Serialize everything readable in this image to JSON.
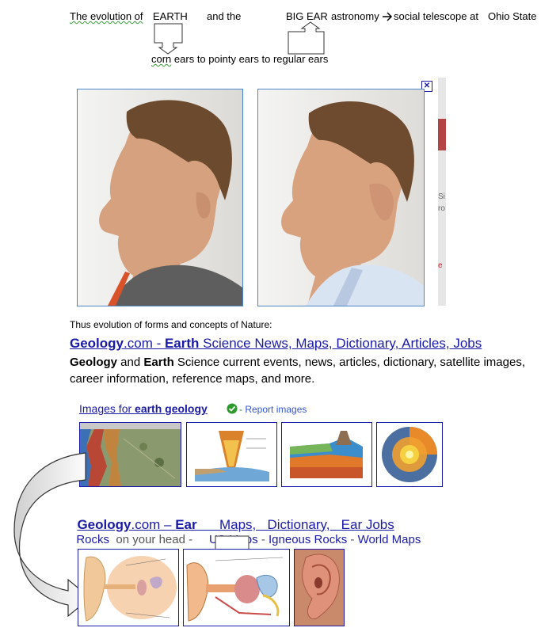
{
  "header": {
    "line1": {
      "the_evolution_of": "The evolution of",
      "earth": "EARTH",
      "and_the": "and the",
      "big_ear": "BIG EAR",
      "astronomy": "astronomy",
      "social_telescope": "social telescope at",
      "ohio_state": "Ohio  State"
    },
    "line2": {
      "corn": "corn",
      "ears_to_pointy": "ears to pointy ears",
      "to_regular_ears": "to regular  ears"
    }
  },
  "popup": {
    "close_glyph": "✕",
    "side_text_1": "Si",
    "side_text_2": "ro",
    "side_text_3": "e"
  },
  "caption": "Thus evolution of forms and concepts of Nature:",
  "result1": {
    "title_parts": [
      "Geology",
      ".com - ",
      "Earth",
      " Science News, Maps, Dictionary, Articles, Jobs"
    ],
    "desc_parts": [
      "Geology",
      " and ",
      "Earth",
      " Science current events, news, articles, dictionary, satellite images,"
    ],
    "desc_line2": "career information, reference maps, and more."
  },
  "images_for": {
    "prefix": "Images for ",
    "query": "earth geology",
    "separator": " - ",
    "report": "Report images"
  },
  "result2": {
    "title_parts": [
      "Geology",
      ".com – ",
      "Ear",
      "      Maps,   Dictionary,   Ear Jobs"
    ],
    "links": {
      "rocks": "Rocks",
      "on_your_head": "on your head",
      "dash": "-",
      "us_maps": "US Maps",
      "sep1": " - ",
      "igneous": "Igneous Rocks",
      "sep2": " - ",
      "world_maps": "World Maps"
    }
  },
  "colors": {
    "link": "#1a1aa6",
    "photo_border": "#4a86c8",
    "green_check": "#2d9a2d"
  }
}
